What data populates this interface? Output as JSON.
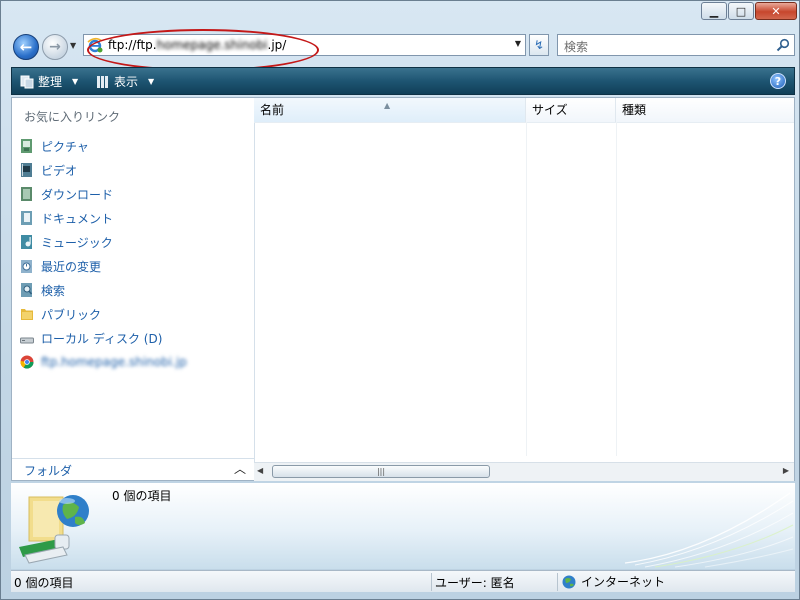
{
  "titlebar": {
    "min_glyph": "▁",
    "max_glyph": "□",
    "close_glyph": "✕"
  },
  "navigation": {
    "back_glyph": "←",
    "forward_glyph": "→",
    "dropdown_glyph": "▼",
    "address": {
      "prefix": "ftp://ftp.",
      "host_blurred": "homepage.shinobi",
      "suffix": ".jp/"
    },
    "refresh_glyph": "↯",
    "search_placeholder": "検索"
  },
  "toolbar": {
    "organize_label": "整理",
    "views_label": "表示",
    "caret": "▼",
    "help_label": "?"
  },
  "favorites": {
    "title": "お気に入りリンク",
    "items": [
      {
        "label": "ピクチャ",
        "icon": "pictures-icon"
      },
      {
        "label": "ビデオ",
        "icon": "videos-icon"
      },
      {
        "label": "ダウンロード",
        "icon": "downloads-icon"
      },
      {
        "label": "ドキュメント",
        "icon": "documents-icon"
      },
      {
        "label": "ミュージック",
        "icon": "music-icon"
      },
      {
        "label": "最近の変更",
        "icon": "recent-changes-icon"
      },
      {
        "label": "検索",
        "icon": "searches-icon"
      },
      {
        "label": "パブリック",
        "icon": "public-folder-icon"
      },
      {
        "label": "ローカル ディスク (D)",
        "icon": "local-disk-icon"
      },
      {
        "label": "ftp.homepage.shinobi.jp",
        "icon": "chrome-icon"
      }
    ]
  },
  "folders": {
    "label": "フォルダ",
    "chevron": "︿"
  },
  "columns": {
    "name": "名前",
    "size": "サイズ",
    "type": "種類",
    "sort_glyph": "▲"
  },
  "scrollbar": {
    "left_glyph": "◀",
    "right_glyph": "▶",
    "grip": "|||"
  },
  "details": {
    "count": "0 個の項目"
  },
  "statusbar": {
    "count": "0 個の項目",
    "user": "ユーザー: 匿名",
    "zone": "インターネット"
  },
  "colors": {
    "toolbar": "#1e5572",
    "link": "#1d5fa9",
    "annotation": "#c41818"
  }
}
